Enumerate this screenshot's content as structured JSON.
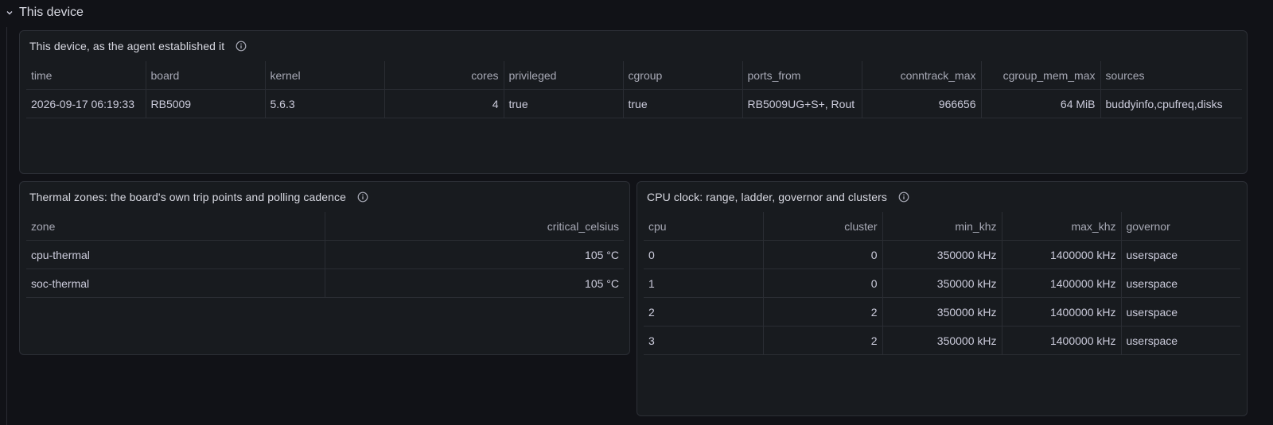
{
  "row": {
    "title": "This device"
  },
  "device_panel": {
    "title": "This device, as the agent established it",
    "columns": [
      "time",
      "board",
      "kernel",
      "cores",
      "privileged",
      "cgroup",
      "ports_from",
      "conntrack_max",
      "cgroup_mem_max",
      "sources"
    ],
    "rows": [
      [
        "2026-09-17 06:19:33",
        "RB5009",
        "5.6.3",
        "4",
        "true",
        "true",
        "RB5009UG+S+, Rout",
        "966656",
        "64 MiB",
        "buddyinfo,cpufreq,disks"
      ]
    ]
  },
  "thermal_panel": {
    "title": "Thermal zones: the board's own trip points and polling cadence",
    "columns": [
      "zone",
      "critical_celsius"
    ],
    "rows": [
      [
        "cpu-thermal",
        "105 °C"
      ],
      [
        "soc-thermal",
        "105 °C"
      ]
    ]
  },
  "cpu_panel": {
    "title": "CPU clock: range, ladder, governor and clusters",
    "columns": [
      "cpu",
      "cluster",
      "min_khz",
      "max_khz",
      "governor"
    ],
    "rows": [
      [
        "0",
        "0",
        "350000 kHz",
        "1400000 kHz",
        "userspace"
      ],
      [
        "1",
        "0",
        "350000 kHz",
        "1400000 kHz",
        "userspace"
      ],
      [
        "2",
        "2",
        "350000 kHz",
        "1400000 kHz",
        "userspace"
      ],
      [
        "3",
        "2",
        "350000 kHz",
        "1400000 kHz",
        "userspace"
      ]
    ]
  },
  "icons": {
    "row_toggle": "chevron-down-icon",
    "panel_info": "info-icon"
  },
  "colors": {
    "background": "#111217",
    "panel": "#181b1f",
    "border": "#2c2f36",
    "text": "#ccccdc"
  }
}
